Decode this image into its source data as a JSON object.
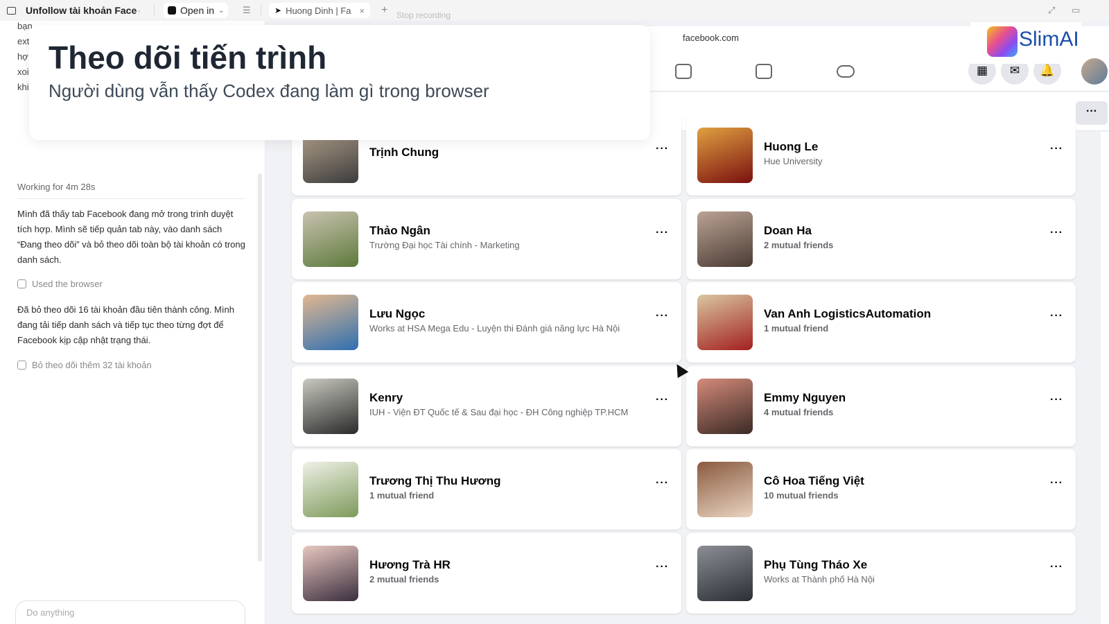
{
  "topbar": {
    "thread_title": "Unfollow tài khoản Face",
    "more": "···",
    "open_in": "Open in",
    "browser_tab": "Huong Dinh | Fa",
    "tab_close": "×",
    "add_tab": "+",
    "stop_recording": "Stop recording"
  },
  "left": {
    "background_fragments": [
      "bạn",
      "ext",
      "hợ",
      "xoi",
      "khi"
    ],
    "working": "Working for 4m 28s",
    "message1": "Mình đã thấy tab Facebook đang mở trong trình duyệt tích hợp. Mình sẽ tiếp quản tab này, vào danh sách “Đang theo dõi” và bỏ theo dõi toàn bộ tài khoản có trong danh sách.",
    "used_browser": "Used the browser",
    "message2": "Đã bỏ theo dõi 16 tài khoản đầu tiên thành công. Mình đang tải tiếp danh sách và tiếp tục theo từng đợt để Facebook kịp cập nhật trạng thái.",
    "task": "Bỏ theo dõi thêm 32 tài khoản",
    "composer_placeholder": "Do anything"
  },
  "overlay": {
    "title": "Theo dõi tiến trình",
    "subtitle": "Người dùng vẫn thấy Codex đang làm gì trong browser"
  },
  "logo": {
    "text": "SlimAI"
  },
  "browser": {
    "url": "facebook.com",
    "more": "···"
  },
  "people": [
    {
      "name": "Trịnh Chung",
      "sub": "",
      "mutual": false,
      "c1": "#3b3b3b",
      "c2": "#b9a690"
    },
    {
      "name": "Huong Le",
      "sub": "Hue University",
      "mutual": false,
      "c1": "#7a1010",
      "c2": "#e0a040"
    },
    {
      "name": "Thảo Ngân",
      "sub": "Trường Đại học Tài chính - Marketing",
      "mutual": false,
      "c1": "#5d7a3a",
      "c2": "#c9c2b0"
    },
    {
      "name": "Doan Ha",
      "sub": "2 mutual friends",
      "mutual": true,
      "c1": "#4a3b33",
      "c2": "#bba395"
    },
    {
      "name": "Lưu Ngọc",
      "sub": "Works at HSA Mega Edu - Luyện thi Đánh giá năng lực Hà Nội",
      "mutual": false,
      "c1": "#2e6fb0",
      "c2": "#e2b890"
    },
    {
      "name": "Van Anh LogisticsAutomation",
      "sub": "1 mutual friend",
      "mutual": true,
      "c1": "#a32020",
      "c2": "#d9c6a0"
    },
    {
      "name": "Kenry",
      "sub": "IUH - Viện ĐT Quốc tế & Sau đại học - ĐH Công nghiệp TP.HCM",
      "mutual": false,
      "c1": "#2a2a2a",
      "c2": "#c9c9c0"
    },
    {
      "name": "Emmy Nguyen",
      "sub": "4 mutual friends",
      "mutual": true,
      "c1": "#3a2a25",
      "c2": "#d48a7a"
    },
    {
      "name": "Trương Thị Thu Hương",
      "sub": "1 mutual friend",
      "mutual": true,
      "c1": "#7d9a5a",
      "c2": "#eef0e6"
    },
    {
      "name": "Cô Hoa Tiếng Việt",
      "sub": "10 mutual friends",
      "mutual": true,
      "c1": "#e9d4c0",
      "c2": "#8a5a40"
    },
    {
      "name": "Hương Trà HR",
      "sub": "2 mutual friends",
      "mutual": true,
      "c1": "#3a2e3e",
      "c2": "#e8c8c0"
    },
    {
      "name": "Phụ Tùng Tháo Xe",
      "sub": "Works at Thành phố Hà Nội",
      "mutual": false,
      "c1": "#2b2f35",
      "c2": "#8b8f95"
    }
  ]
}
